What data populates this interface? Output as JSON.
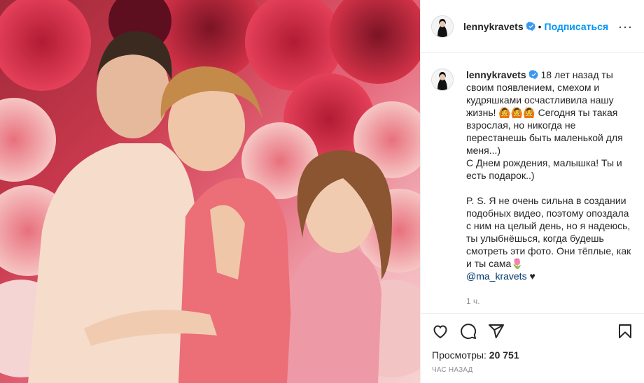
{
  "colors": {
    "accent": "#0095f6",
    "mention": "#00376b",
    "muted": "#8e8e8e",
    "text": "#262626"
  },
  "photo": {
    "description_icon": "family-photo-image"
  },
  "header": {
    "username": "lennykravets",
    "separator": "•",
    "follow_label": "Подписаться",
    "more_label": "···"
  },
  "caption": {
    "username": "lennykravets",
    "para1": "18 лет назад ты своим появлением, смехом и кудряшками осчастливила нашу жизнь! 🙆🙆🙆 Сегодня ты такая взрослая, но никогда не перестанешь быть маленькой для меня...)",
    "para2": "С Днем рождения, малышка! Ты и есть подарок..)",
    "para3": "P. S. Я не очень сильна в создании подобных видео, поэтому опоздала с ним на целый день, но я надеюсь, ты улыбнёшься, когда будешь смотреть эти фото. Они тёплые, как и ты сама🌷",
    "mention": "@ma_kravets",
    "heart": "♥",
    "time": "1 ч."
  },
  "stats": {
    "views_label": "Просмотры:",
    "views_count": "20 751",
    "posted": "час назад"
  }
}
